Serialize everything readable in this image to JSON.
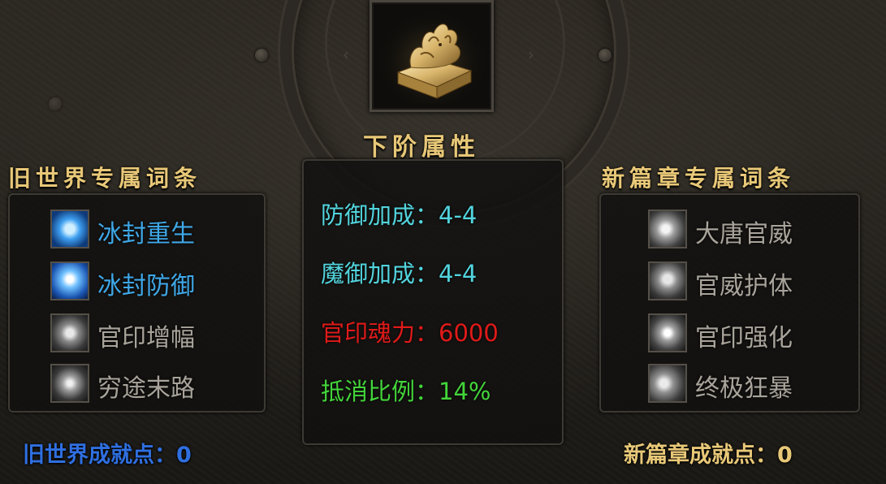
{
  "center": {
    "item_icon": "gold-dragon-seal-icon",
    "title": "下阶属性",
    "stats": [
      {
        "label": "防御加成：",
        "value": "4-4",
        "color": "#52d4dd"
      },
      {
        "label": "魔御加成：",
        "value": "4-4",
        "color": "#52d4dd"
      },
      {
        "label": "官印魂力：",
        "value": "6000",
        "color": "#e01a1a"
      },
      {
        "label": "抵消比例：",
        "value": "14%",
        "color": "#43d43a"
      }
    ]
  },
  "left": {
    "title": "旧世界专属词条",
    "entries": [
      {
        "label": "冰封重生",
        "icon": "ice-rebirth-icon",
        "active": true
      },
      {
        "label": "冰封防御",
        "icon": "ice-defense-icon",
        "active": true
      },
      {
        "label": "官印增幅",
        "icon": "seal-amplify-icon",
        "active": false
      },
      {
        "label": "穷途末路",
        "icon": "dead-end-icon",
        "active": false
      }
    ],
    "points_label": "旧世界成就点：",
    "points_value": "0"
  },
  "right": {
    "title": "新篇章专属词条",
    "entries": [
      {
        "label": "大唐官威",
        "icon": "tang-authority-icon",
        "active": false
      },
      {
        "label": "官威护体",
        "icon": "authority-shield-icon",
        "active": false
      },
      {
        "label": "官印强化",
        "icon": "seal-enhance-icon",
        "active": false
      },
      {
        "label": "终极狂暴",
        "icon": "ultimate-rage-icon",
        "active": false
      }
    ],
    "points_label": "新篇章成就点：",
    "points_value": "0"
  },
  "colors": {
    "gold_title": "#e8c878",
    "active_entry": "#3fa8e8",
    "inactive_entry": "#a9a49b",
    "left_points": "#2f6fe0",
    "right_points": "#e8c878"
  }
}
